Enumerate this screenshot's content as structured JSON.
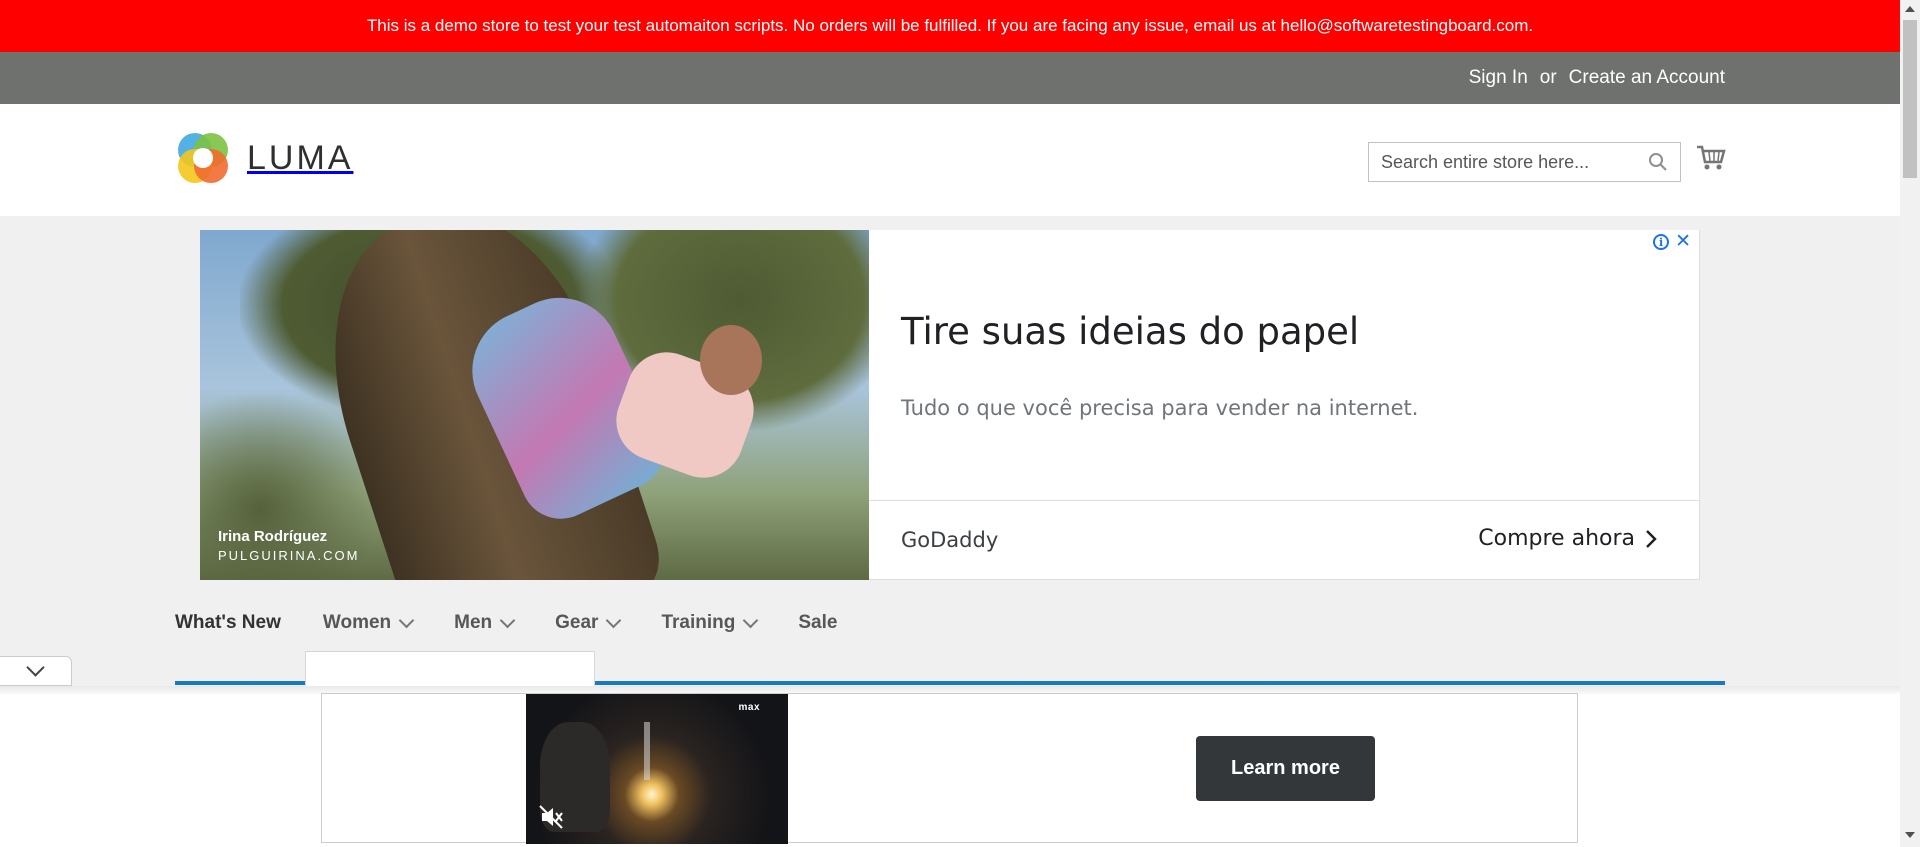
{
  "demo_notice": "This is a demo store to test your test automaiton scripts. No orders will be fulfilled. If you are facing any issue, email us at hello@softwaretestingboard.com.",
  "auth": {
    "sign_in": "Sign In",
    "or": "or",
    "create_account": "Create an Account"
  },
  "header": {
    "logo_text": "LUMA",
    "search_placeholder": "Search entire store here...",
    "search_value": ""
  },
  "ad": {
    "photo_credit_name": "Irina Rodríguez",
    "photo_credit_site": "PULGUIRINA.COM",
    "headline": "Tire suas ideias do papel",
    "subtext": "Tudo o que você precisa para vender na internet.",
    "advertiser": "GoDaddy",
    "cta": "Compre ahora"
  },
  "nav": {
    "items": [
      {
        "label": "What's New",
        "dropdown": false
      },
      {
        "label": "Women",
        "dropdown": true
      },
      {
        "label": "Men",
        "dropdown": true
      },
      {
        "label": "Gear",
        "dropdown": true
      },
      {
        "label": "Training",
        "dropdown": true
      },
      {
        "label": "Sale",
        "dropdown": false
      }
    ]
  },
  "bottom_ad": {
    "video_badge": "max",
    "button": "Learn more"
  },
  "colors": {
    "demo_bar": "#ff0000",
    "auth_bar": "#6e716e",
    "nav_underline": "#1979c3",
    "learn_more_button": "#34373a"
  }
}
